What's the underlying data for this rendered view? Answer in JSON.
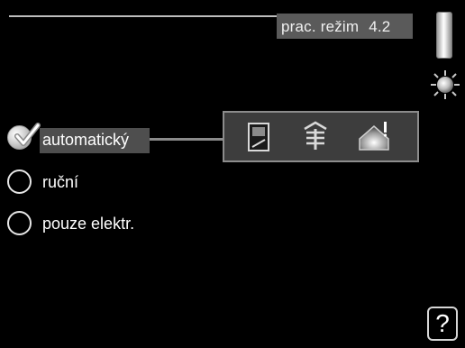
{
  "header": {
    "title": "prac. režim",
    "menu_number": "4.2"
  },
  "options": [
    {
      "label": "automatický",
      "selected": true
    },
    {
      "label": "ruční",
      "selected": false
    },
    {
      "label": "pouze elektr.",
      "selected": false
    }
  ],
  "icons": {
    "panel": [
      "hot-water-tank-icon",
      "heating-radiator-icon",
      "outdoor-heat-pump-icon"
    ],
    "status": "sun-icon",
    "help": "?"
  },
  "colors": {
    "background": "#000000",
    "title_box": "#5a5a5a",
    "selection": "#4e4e4e",
    "panel": "#3d3d3d",
    "text": "#ffffff"
  }
}
